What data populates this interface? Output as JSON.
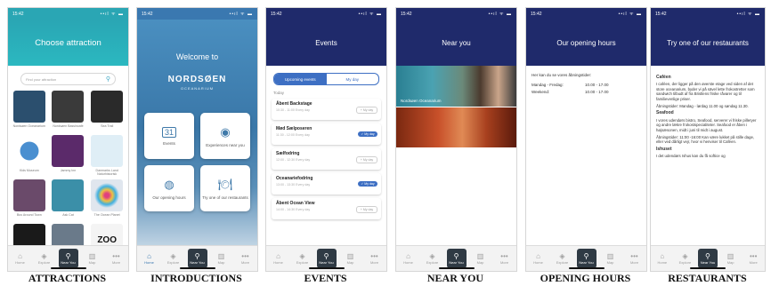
{
  "status": {
    "time": "15:42",
    "signal": "••ıl ᯤ ▬"
  },
  "tabbar": [
    {
      "label": "Home",
      "icon": "⌂"
    },
    {
      "label": "Explore",
      "icon": "◈"
    },
    {
      "label": "Near You",
      "icon": "⚲"
    },
    {
      "label": "Map",
      "icon": "▥"
    },
    {
      "label": "More",
      "icon": "•••"
    }
  ],
  "captions": [
    "ATTRACTIONS",
    "INTRODUCTIONS",
    "EVENTS",
    "NEAR YOU",
    "OPENING HOURS",
    "RESTAURANTS"
  ],
  "attractions": {
    "title": "Choose attraction",
    "search_placeholder": "Find your attraction",
    "items": [
      {
        "label": "Nordsøen Oceanarium",
        "color": "#2b4f6e"
      },
      {
        "label": "Nordsøen Bassincafé",
        "color": "#3a3a3a"
      },
      {
        "label": "Sea Trail",
        "color": "#2a2a2a"
      },
      {
        "label": "Kids Museum",
        "color": "#4a8fd0"
      },
      {
        "label": "Jammy Inn",
        "color": "#5b2a6a"
      },
      {
        "label": "Danmarks Land Naturhistorisk",
        "color": "#dfeef6"
      },
      {
        "label": "Bus Around Town",
        "color": "#6a4a6a"
      },
      {
        "label": "Ask Cat",
        "color": "#3b8fa8"
      },
      {
        "label": "The Ocean Planet",
        "color": "#e0e6ee"
      },
      {
        "label": "",
        "color": "#1a1a1a"
      },
      {
        "label": "",
        "color": "#6a7a8a"
      },
      {
        "label": "",
        "color": "#f4f4f4"
      }
    ],
    "zoo_text": "ZOO"
  },
  "intro": {
    "welcome": "Welcome to",
    "brand": "NORDSØEN",
    "brand_sub": "OCEANARIUM",
    "cards": [
      {
        "label": "Events",
        "icon": "31"
      },
      {
        "label": "Experiences near you",
        "icon": "◉"
      },
      {
        "label": "Our opening hours",
        "icon": "◍"
      },
      {
        "label": "Try one of our restaurants",
        "icon": "🍽"
      }
    ]
  },
  "events": {
    "title": "Events",
    "tab_upcoming": "Upcoming events",
    "tab_mine": "My day",
    "today_label": "Today",
    "items": [
      {
        "name": "Åbent Backstage",
        "sub": "10:30 - 11:00 Every day",
        "btn": "+ My day",
        "selected": false
      },
      {
        "name": "Mød Sælposeren",
        "sub": "11:30 - 12:00 Every day",
        "btn": "✓ My day",
        "selected": true
      },
      {
        "name": "Sælfodring",
        "sub": "12:00 - 12:30 Every day",
        "btn": "+ My day",
        "selected": false
      },
      {
        "name": "Oceanariefodring",
        "sub": "13:00 - 13:30 Every day",
        "btn": "✓ My day",
        "selected": true
      },
      {
        "name": "Åbent Ocean View",
        "sub": "14:00 - 14:30 Every day",
        "btn": "+ My day",
        "selected": false
      }
    ]
  },
  "near": {
    "title": "Near you",
    "items": [
      {
        "label": "Nordsøen Oceanarium"
      },
      {
        "label": ""
      }
    ]
  },
  "hours": {
    "title": "Our opening hours",
    "intro": "Her kan du se vores åbningstider:",
    "rows": [
      {
        "day": "Mandag - Fredag:",
        "time": "10.00 - 17.00"
      },
      {
        "day": "Weekend:",
        "time": "10.00 - 17.00"
      }
    ]
  },
  "restaurants": {
    "title": "Try one of our restaurants",
    "sections": [
      {
        "heading": "Caféen",
        "paras": [
          "I caféen, der ligger på den øverste etage ved siden af det store oceanarium, byder vi på sävel lette frokostretter som sandwich tilbudt af fra Bristlens friske råvarer og til familievenlige priser.",
          "Åbningstider: Mandag - lørdag 11.00 og søndag 11.30."
        ]
      },
      {
        "heading": "Seafood",
        "paras": [
          "I vores udendørs bistro, Seafood, serverer vi friske pilleryer og andre lækre frokostspecialiteter. Seafood er åben i højsæsonen, midt i juni til midt i august.",
          "Åbningstider: 11:00 -16:00 Kan være lukket på stille dage, eller ved dårligt vejr, hvor vi henviser til Caféen."
        ]
      },
      {
        "heading": "Ishuset",
        "paras": [
          "I det udendørs Ishus kan du få softice og"
        ]
      }
    ]
  },
  "colors": {
    "teal": "#2aa6b4",
    "navy": "#1f2a6b",
    "blue": "#3d6fc3"
  }
}
